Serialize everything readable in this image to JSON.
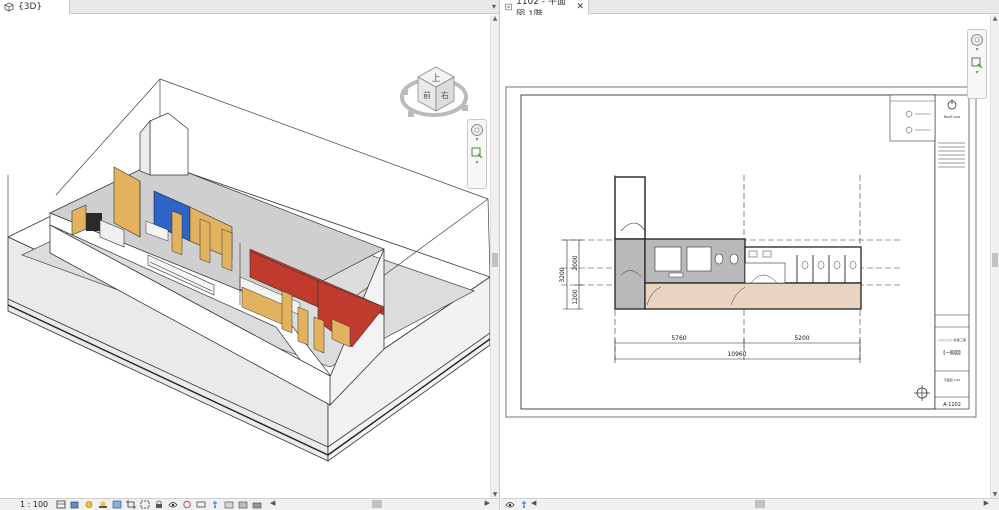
{
  "left_view": {
    "tab_title": "{3D}",
    "view_scale": "1 : 100",
    "viewcube": {
      "top_label": "上",
      "front_label": "前",
      "right_label": "右"
    }
  },
  "right_view": {
    "tab_title": "1102 - 平面図 1階",
    "tab_close": "✕",
    "sheet": {
      "dimension_total": "10960",
      "dimension_left": "5760",
      "dimension_right": "5200",
      "dimension_vert_1": "3200",
      "dimension_vert_2": "2000",
      "dimension_vert_3": "1200",
      "sheet_number": "A-1102",
      "title_label": "【一般図】",
      "company_label": "BooT.one",
      "project_label": "○○○○○○新築工事",
      "scale_note": "平面図 1/40"
    }
  },
  "colors": {
    "tab_bar": "#e9e9e9",
    "wall": "#ffffff",
    "floor": "#cfcfcf",
    "blue_wall": "#2e64c8",
    "red_wall": "#c03a2e",
    "wood": "#e3b25e",
    "plan_tint_gray": "#b9b9b9",
    "plan_tint_beige": "#e8d4c0"
  }
}
